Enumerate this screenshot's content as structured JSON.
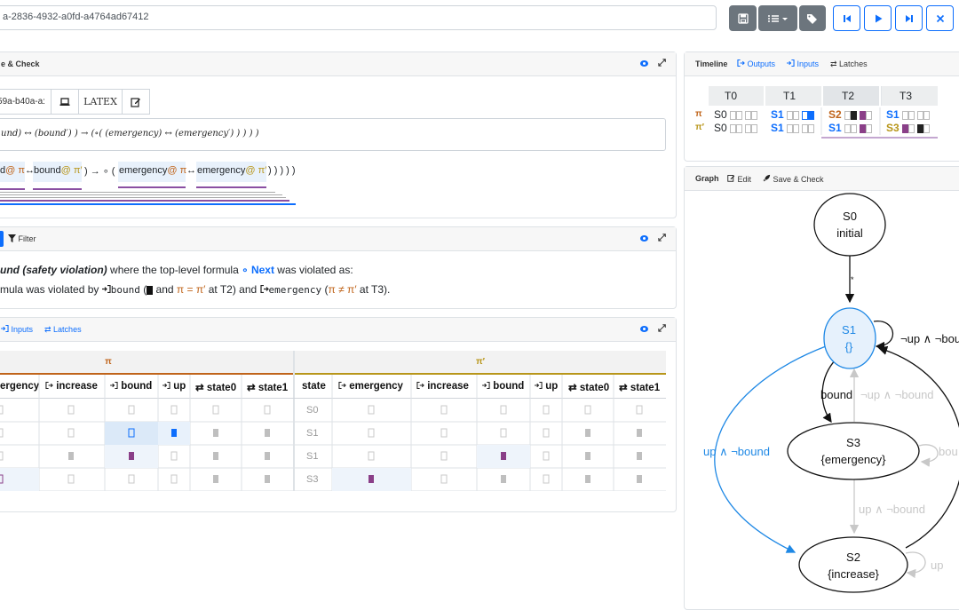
{
  "colors": {
    "accent": "#0d6efd",
    "purple": "#8a4fa2",
    "orange_pi": "#c0641a",
    "olive_pi2": "#b8961a",
    "gray": "#6c757d",
    "dark": "#1b1b1b"
  },
  "topbar": {
    "spec_id": "a-2836-4932-a0fd-a4764ad67412",
    "buttons": [
      {
        "icon": "save-icon",
        "style": "gray"
      },
      {
        "icon": "list-dropdown-icon",
        "style": "gray"
      },
      {
        "icon": "tags-icon",
        "style": "gray"
      },
      {
        "icon": "skip-back-icon",
        "style": "blue"
      },
      {
        "icon": "play-icon",
        "style": "blue"
      },
      {
        "icon": "skip-forward-icon",
        "style": "blue"
      },
      {
        "icon": "close-icon",
        "style": "blue"
      }
    ]
  },
  "formula_panel": {
    "title": "e & Check",
    "tab_id": "59a-b40a-a:",
    "latex_label": "LATEX",
    "formula_text": "und) ↔ (bound′) ) → (∘( (emergency) ↔ (emergency′) ) ) ) )",
    "annotated": [
      {
        "text": "d",
        "trace": "@ π"
      },
      {
        "op": "↔"
      },
      {
        "text": "bound",
        "trace": "@ π′"
      },
      {
        "op": ") → ∘ ( ("
      },
      {
        "text": "emergency",
        "trace": "@ π"
      },
      {
        "op": "↔"
      },
      {
        "text": "emergency",
        "trace": "@ π′"
      },
      {
        "op": ") ) ) ) )"
      }
    ]
  },
  "filter_panel": {
    "filter_label": "Filter",
    "line1_a": "und (safety violation)",
    "line1_b": " where the top-level formula ",
    "line1_c": "∘ Next",
    "line1_d": " was violated as:",
    "line2_a": "mula was violated by ",
    "line2_b": "bound",
    "line2_c": " (",
    "line2_d": " and ",
    "line2_e": "π = π′",
    "line2_f": " at T2) and ",
    "line2_g": "emergency",
    "line2_h": " (",
    "line2_i": "π ≠ π′",
    "line2_j": " at T3)."
  },
  "trace_panel": {
    "tabs": [
      "Inputs",
      "Latches"
    ],
    "pi_label": "π",
    "pi2_label": "π′",
    "left_cols": [
      "ergency",
      "increase",
      "bound",
      "up",
      "state0",
      "state1"
    ],
    "right_cols": [
      "state",
      "emergency",
      "increase",
      "bound",
      "up",
      "state0",
      "state1"
    ],
    "rows": [
      {
        "state": "S0"
      },
      {
        "state": "S1"
      },
      {
        "state": "S1"
      },
      {
        "state": "S3"
      }
    ]
  },
  "timeline_panel": {
    "title": "Timeline",
    "tabs": [
      "Outputs",
      "Inputs",
      "Latches"
    ],
    "cols": [
      "T0",
      "T1",
      "T2",
      "T3"
    ],
    "pi_label": "π",
    "pi2_label": "π′",
    "pi_states": [
      "S0",
      "S1",
      "S2",
      "S1"
    ],
    "pi2_states": [
      "S0",
      "S1",
      "S1",
      "S3"
    ]
  },
  "graph_panel": {
    "title": "Graph",
    "edit_label": "Edit",
    "save_label": "Save & Check",
    "nodes": [
      {
        "id": "S0",
        "sub": "initial"
      },
      {
        "id": "S1",
        "sub": "{}"
      },
      {
        "id": "S3",
        "sub": "{emergency}"
      },
      {
        "id": "S2",
        "sub": "{increase}"
      }
    ],
    "edges": {
      "s0_s1": "*",
      "s1_self": "¬up ∧ ¬bound",
      "s1_s3": "bound",
      "s3_s1": "¬up ∧ ¬bound",
      "s1_s2": "up ∧ ¬bound",
      "s3_self": "bou",
      "s3_s2": "up ∧ ¬bound",
      "s2_self": "up"
    }
  }
}
